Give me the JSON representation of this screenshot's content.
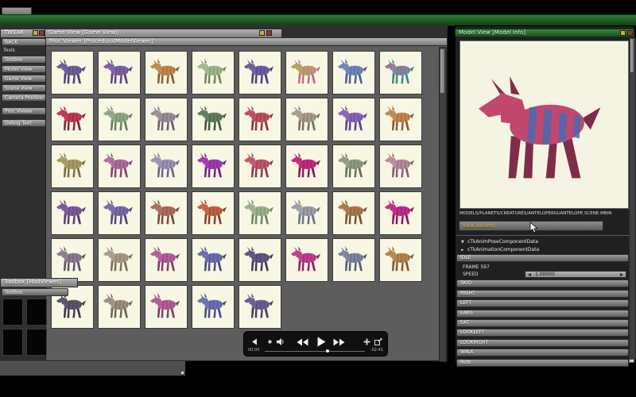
{
  "tweak": {
    "title": "TWEAK",
    "back": "BACK",
    "tools_label": "Tools",
    "buttons": [
      "Toolbox",
      "Model View",
      "Game View",
      "Scene View",
      "Camera Position",
      "Proc Viewer",
      "Debug Text"
    ]
  },
  "game_view": {
    "title": "Game View  [Game View]"
  },
  "proc_viewer": {
    "title": "Proc Viewer  [ProceduralModelViewer]"
  },
  "toolbox": {
    "title": "Toolbox  [HudViewer]",
    "header": "Toolbox",
    "slots": 4
  },
  "model_view": {
    "title": "Model View  [Model Info]",
    "path": "MODELS/PLANETS/CREATURES/ANTELOPERIG/ANTELOPE.SCENE.MBIN",
    "view_variants": "View Variants",
    "tree": [
      {
        "arrow": "▼",
        "label": "cTkAnimPoseComponentData"
      },
      {
        "arrow": "►",
        "label": "cTkAnimationComponentData"
      }
    ],
    "idle_detail": {
      "frame": "FRAME 597",
      "speed_label": "SPEED",
      "speed_value": "1.00000"
    },
    "sections": [
      "IDLE",
      "SKID",
      "RIGHT",
      "LEFT",
      "EARS",
      "EAT",
      "LOOKLEFT",
      "LOOKRIGHT",
      "WALK",
      "RUN"
    ],
    "model_colors": {
      "body": "#c2476e",
      "shade": "#7e2c4a",
      "stripe": "#4a6ab0"
    }
  },
  "player": {
    "elapsed": "00:00",
    "remaining": "-02:41",
    "icons": [
      "skip-back",
      "record",
      "speaker",
      "rewind",
      "play",
      "fast-forward",
      "volume",
      "external"
    ]
  },
  "colors": {
    "active_titlebar_green": "#2a7030",
    "workspace_gray": "#2f2f2f",
    "cell_cream": "#f8f7e3"
  },
  "grid": {
    "columns": 8,
    "creatures": [
      {
        "b": "#6e6298",
        "a": "#4a4276"
      },
      {
        "b": "#8262a6",
        "a": "#5a4480"
      },
      {
        "b": "#c08a52",
        "a": "#8a5c34"
      },
      {
        "b": "#a3b88e",
        "a": "#6f8a5f"
      },
      {
        "b": "#6f5f9e",
        "a": "#4b3f74"
      },
      {
        "b": "#b5a06a",
        "a": "#c76a8a"
      },
      {
        "b": "#7287b8",
        "a": "#4a5f92"
      },
      {
        "b": "#8f7fa0",
        "a": "#35907f"
      },
      {
        "b": "#c23a56",
        "a": "#88243c"
      },
      {
        "b": "#93a886",
        "a": "#66805c"
      },
      {
        "b": "#9c8e9a",
        "a": "#6e616d"
      },
      {
        "b": "#637f5e",
        "a": "#42593f"
      },
      {
        "b": "#c2505e",
        "a": "#8a3340"
      },
      {
        "b": "#aa9d89",
        "a": "#7a6f5e"
      },
      {
        "b": "#8c64bb",
        "a": "#614289"
      },
      {
        "b": "#c58852",
        "a": "#8e5c34"
      },
      {
        "b": "#aa9d62",
        "a": "#7a6f40"
      },
      {
        "b": "#b06f9d",
        "a": "#7e476f"
      },
      {
        "b": "#9c93b8",
        "a": "#6d6589"
      },
      {
        "b": "#a23cb3",
        "a": "#722482"
      },
      {
        "b": "#c2586c",
        "a": "#8a3849"
      },
      {
        "b": "#c42c7c",
        "a": "#8e1656"
      },
      {
        "b": "#929d88",
        "a": "#65705c"
      },
      {
        "b": "#b78da0",
        "a": "#855f74"
      },
      {
        "b": "#7d5c9e",
        "a": "#563c74"
      },
      {
        "b": "#7d6cab",
        "a": "#56477e"
      },
      {
        "b": "#b26e5c",
        "a": "#81463a"
      },
      {
        "b": "#c26446",
        "a": "#8c3f2a"
      },
      {
        "b": "#9eb38e",
        "a": "#6f8560"
      },
      {
        "b": "#9ea0ab",
        "a": "#6e707e"
      },
      {
        "b": "#ab7a52",
        "a": "#7b5233"
      },
      {
        "b": "#c42e88",
        "a": "#8e1860"
      },
      {
        "b": "#8e7e93",
        "a": "#615466"
      },
      {
        "b": "#a89e88",
        "a": "#786e5c"
      },
      {
        "b": "#b75f9e",
        "a": "#853d70"
      },
      {
        "b": "#6e6eb3",
        "a": "#494982"
      },
      {
        "b": "#635887",
        "a": "#423a5e"
      },
      {
        "b": "#c23e8e",
        "a": "#8c2464"
      },
      {
        "b": "#7e88a3",
        "a": "#565e75"
      },
      {
        "b": "#b5884f",
        "a": "#835c31"
      },
      {
        "b": "#60566b",
        "a": "#3e3748"
      },
      {
        "b": "#9e9280",
        "a": "#6f6556"
      },
      {
        "b": "#b25e98",
        "a": "#813d6c"
      },
      {
        "b": "#6e74b3",
        "a": "#494e82"
      },
      {
        "b": "#6e5e93",
        "a": "#4a3e66"
      }
    ]
  }
}
